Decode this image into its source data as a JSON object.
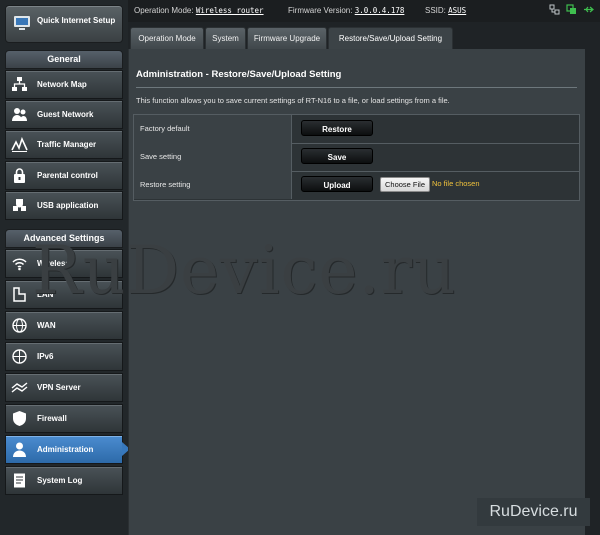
{
  "sidebar": {
    "quick_setup_label": "Quick Internet Setup",
    "general_header": "General",
    "general_items": [
      {
        "label": "Network Map",
        "icon": "network-map-icon"
      },
      {
        "label": "Guest Network",
        "icon": "guest-network-icon"
      },
      {
        "label": "Traffic Manager",
        "icon": "traffic-manager-icon"
      },
      {
        "label": "Parental control",
        "icon": "parental-control-icon"
      },
      {
        "label": "USB application",
        "icon": "usb-application-icon"
      }
    ],
    "advanced_header": "Advanced Settings",
    "advanced_items": [
      {
        "label": "Wireless",
        "icon": "wireless-icon"
      },
      {
        "label": "LAN",
        "icon": "lan-icon"
      },
      {
        "label": "WAN",
        "icon": "wan-icon"
      },
      {
        "label": "IPv6",
        "icon": "ipv6-icon"
      },
      {
        "label": "VPN Server",
        "icon": "vpn-server-icon"
      },
      {
        "label": "Firewall",
        "icon": "firewall-icon"
      },
      {
        "label": "Administration",
        "icon": "administration-icon",
        "active": true
      },
      {
        "label": "System Log",
        "icon": "system-log-icon"
      }
    ]
  },
  "topbar": {
    "operation_mode_label": "Operation Mode:",
    "operation_mode_value": "Wireless router",
    "firmware_label": "Firmware Version:",
    "firmware_value": "3.0.0.4.178",
    "ssid_label": "SSID:",
    "ssid_value": "ASUS"
  },
  "tabs": [
    {
      "label": "Operation Mode"
    },
    {
      "label": "System"
    },
    {
      "label": "Firmware Upgrade"
    },
    {
      "label": "Restore/Save/Upload Setting",
      "active": true
    }
  ],
  "panel": {
    "title": "Administration - Restore/Save/Upload Setting",
    "description": "This function allows you to save current settings of RT-N16 to a file, or load settings from a file.",
    "rows": [
      {
        "label": "Factory default",
        "button": "Restore"
      },
      {
        "label": "Save setting",
        "button": "Save"
      },
      {
        "label": "Restore setting",
        "button": "Upload",
        "file_button": "Choose File",
        "file_status": "No file chosen"
      }
    ]
  },
  "watermark": "RuDevice.ru",
  "badge": "RuDevice.ru",
  "colors": {
    "accent": "#3778bd",
    "file_status": "#f0c23c"
  }
}
